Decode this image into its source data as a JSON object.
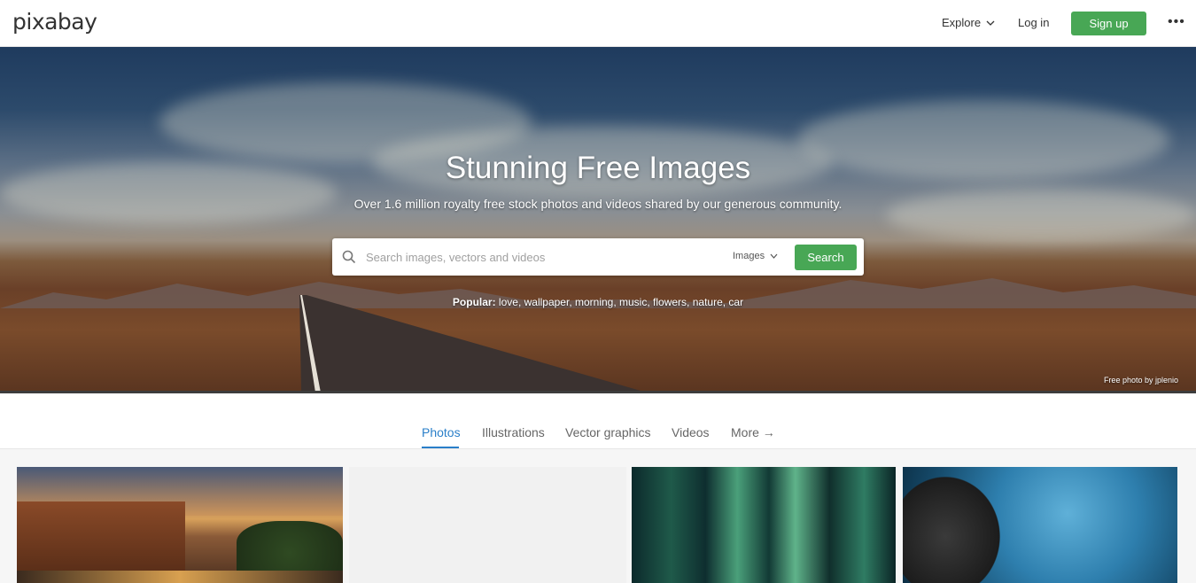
{
  "header": {
    "logo": "pixabay",
    "explore_label": "Explore",
    "login_label": "Log in",
    "signup_label": "Sign up",
    "more_label": "•••"
  },
  "hero": {
    "title": "Stunning Free Images",
    "subtitle": "Over 1.6 million royalty free stock photos and videos shared by our generous community.",
    "search": {
      "placeholder": "Search images, vectors and videos",
      "value": "",
      "type_selected": "Images",
      "button_label": "Search"
    },
    "popular": {
      "label": "Popular:",
      "tags": [
        "love",
        "wallpaper",
        "morning",
        "music",
        "flowers",
        "nature",
        "car"
      ]
    },
    "credit": "Free photo by jplenio"
  },
  "tabs": [
    {
      "label": "Photos",
      "active": true
    },
    {
      "label": "Illustrations",
      "active": false
    },
    {
      "label": "Vector graphics",
      "active": false
    },
    {
      "label": "Videos",
      "active": false
    },
    {
      "label": "More →",
      "active": false
    }
  ],
  "colors": {
    "accent_green": "#48a755",
    "tab_active_blue": "#2a7fc9"
  }
}
